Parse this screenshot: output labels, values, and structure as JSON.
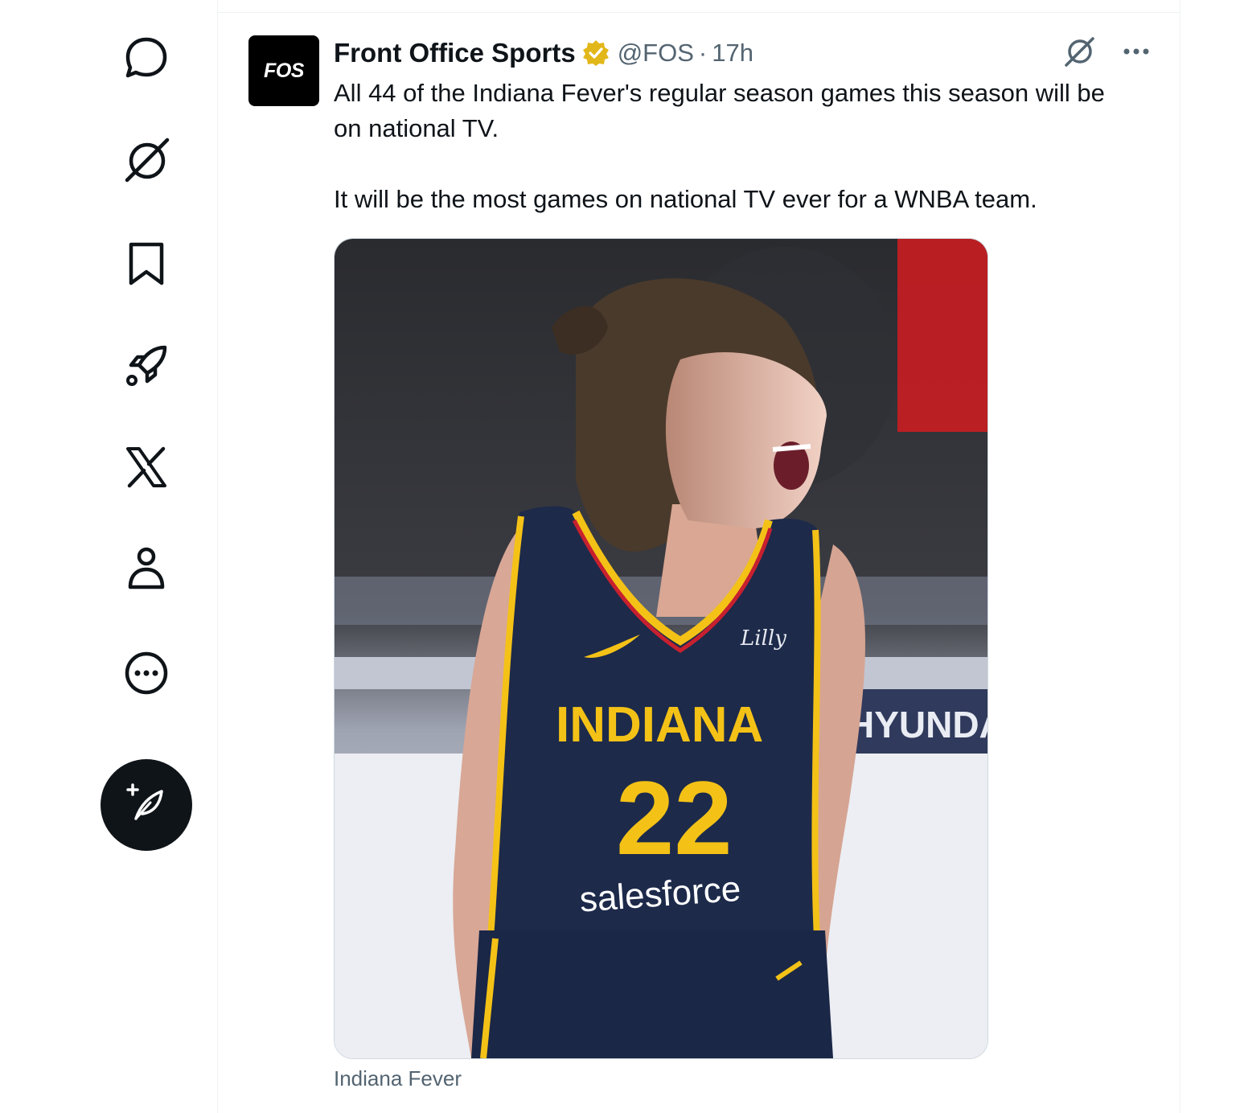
{
  "sidebar": {
    "items": [
      {
        "icon": "chat-bubble-icon",
        "label": "Messages"
      },
      {
        "icon": "grok-icon",
        "label": "Grok"
      },
      {
        "icon": "bookmark-icon",
        "label": "Bookmarks"
      },
      {
        "icon": "rocket-icon",
        "label": "Jobs"
      },
      {
        "icon": "x-logo-icon",
        "label": "Premium"
      },
      {
        "icon": "person-icon",
        "label": "Profile"
      },
      {
        "icon": "more-circle-icon",
        "label": "More"
      }
    ],
    "compose_icon": "feather-plus-icon"
  },
  "tweet": {
    "avatar_text": "FOS",
    "display_name": "Front Office Sports",
    "verified": true,
    "verified_color": "#e2b719",
    "handle": "@FOS",
    "separator": "·",
    "timestamp": "17h",
    "text_paragraphs": [
      "All 44 of the Indiana Fever's regular season games this season will be on national TV.",
      "It will be the most games on national TV ever for a WNBA team."
    ],
    "media": {
      "jersey_team": "INDIANA",
      "jersey_number": "22",
      "jersey_sponsor": "salesforce",
      "jersey_patch": "Lilly",
      "arena_ad": "HYUNDAI"
    },
    "media_caption": "Indiana Fever"
  },
  "colors": {
    "text_primary": "#0f1419",
    "text_secondary": "#536471",
    "jersey_navy": "#1d2a4a",
    "jersey_gold": "#f4c217",
    "jersey_red": "#c8202f"
  }
}
